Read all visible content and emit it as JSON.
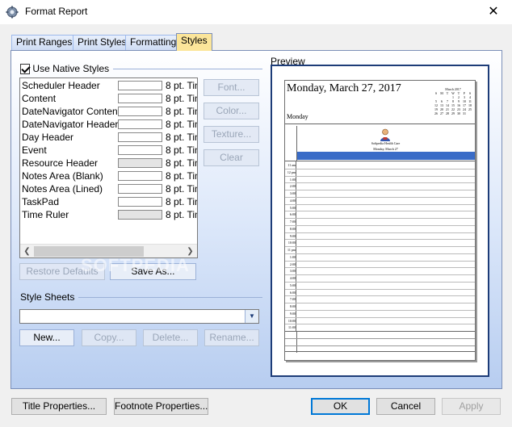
{
  "window": {
    "title": "Format Report",
    "close_glyph": "✕"
  },
  "tabs": [
    {
      "label": "Print Ranges"
    },
    {
      "label": "Print Styles"
    },
    {
      "label": "Formatting"
    },
    {
      "label": "Styles",
      "active": true
    }
  ],
  "native_styles": {
    "label": "Use Native Styles",
    "checked": true
  },
  "style_items": [
    {
      "name": "Scheduler Header",
      "font": "8 pt. Tin",
      "filled": false
    },
    {
      "name": "Content",
      "font": "8 pt. Tin",
      "filled": false
    },
    {
      "name": "DateNavigator Content",
      "font": "8 pt. Tin",
      "filled": false
    },
    {
      "name": "DateNavigator Header",
      "font": "8 pt. Tin",
      "filled": false
    },
    {
      "name": "Day Header",
      "font": "8 pt. Tin",
      "filled": false
    },
    {
      "name": "Event",
      "font": "8 pt. Tin",
      "filled": false
    },
    {
      "name": "Resource Header",
      "font": "8 pt. Tin",
      "filled": true
    },
    {
      "name": "Notes Area (Blank)",
      "font": "8 pt. Tin",
      "filled": false
    },
    {
      "name": "Notes Area (Lined)",
      "font": "8 pt. Tin",
      "filled": false
    },
    {
      "name": "TaskPad",
      "font": "8 pt. Tin",
      "filled": false
    },
    {
      "name": "Time Ruler",
      "font": "8 pt. Tin",
      "filled": true
    }
  ],
  "side_buttons": {
    "font": "Font...",
    "color": "Color...",
    "texture": "Texture...",
    "clear": "Clear"
  },
  "list_buttons": {
    "restore": "Restore Defaults",
    "save_as": "Save As..."
  },
  "style_sheets": {
    "label": "Style Sheets",
    "value": "",
    "new": "New...",
    "copy": "Copy...",
    "delete": "Delete...",
    "rename": "Rename..."
  },
  "preview": {
    "label": "Preview",
    "date": "Monday, March 27, 2017",
    "day": "Monday",
    "resource_name": "Softpedia Health Care",
    "resource_date": "Monday, March 27",
    "mini_calendar": {
      "title": "March 2017",
      "rows": [
        [
          "S",
          "M",
          "T",
          "W",
          "T",
          "F",
          "S"
        ],
        [
          "",
          "",
          "",
          "1",
          "2",
          "3",
          "4"
        ],
        [
          "5",
          "6",
          "7",
          "8",
          "9",
          "10",
          "11"
        ],
        [
          "12",
          "13",
          "14",
          "15",
          "16",
          "17",
          "18"
        ],
        [
          "19",
          "20",
          "21",
          "22",
          "23",
          "24",
          "25"
        ],
        [
          "26",
          "27",
          "28",
          "29",
          "30",
          "31",
          ""
        ]
      ]
    },
    "times": [
      "11 am",
      "12 pm",
      "1:00",
      "2:00",
      "3:00",
      "4:00",
      "5:00",
      "6:00",
      "7:00",
      "8:00",
      "9:00",
      "10:00",
      "11 pm",
      "1:00",
      "2:00",
      "3:00",
      "4:00",
      "5:00",
      "6:00",
      "7:00",
      "8:00",
      "9:00",
      "10:00",
      "11:00"
    ]
  },
  "watermark": "SOFTPEDIA",
  "bottom_buttons": {
    "title_props": "Title Properties...",
    "footnote_props": "Footnote Properties...",
    "ok": "OK",
    "cancel": "Cancel",
    "apply": "Apply"
  },
  "colors": {
    "accent": "#0078d7",
    "active_tab": "#fbe59a",
    "preview_band": "#3a6cc7",
    "frame": "#1d3c78"
  }
}
